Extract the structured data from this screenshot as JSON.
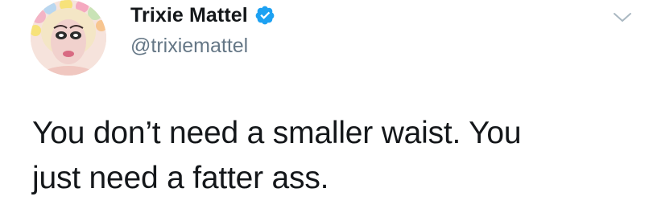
{
  "author": {
    "display_name": "Trixie Mattel",
    "handle": "@trixiemattel",
    "verified": true,
    "avatar_icon": "profile-photo"
  },
  "tweet": {
    "lines": [
      "You don’t need a smaller waist. You",
      "just need a fatter ass."
    ]
  },
  "icons": {
    "verified": "verified-badge-icon",
    "caret": "chevron-down-icon"
  },
  "colors": {
    "verified_blue": "#1da1f2",
    "handle_gray": "#657786",
    "text": "#14171a",
    "caret_gray": "#aab8c2"
  }
}
